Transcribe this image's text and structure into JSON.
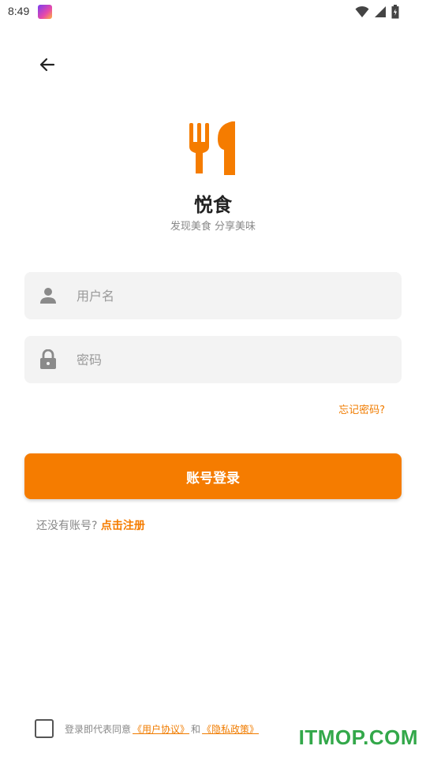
{
  "status_bar": {
    "time": "8:49",
    "icons": [
      "app-notification-icon",
      "wifi-icon",
      "signal-icon",
      "battery-icon"
    ]
  },
  "header": {
    "back_icon": "back-arrow-icon"
  },
  "brand": {
    "logo_icon": "fork-knife-icon",
    "app_name": "悦食",
    "slogan": "发现美食 分享美味",
    "accent_color": "#f57c00"
  },
  "form": {
    "username": {
      "placeholder": "用户名",
      "value": "",
      "icon": "person-icon"
    },
    "password": {
      "placeholder": "密码",
      "value": "",
      "icon": "lock-icon"
    },
    "forgot_password": "忘记密码?",
    "login_button": "账号登录"
  },
  "register": {
    "prompt": "还没有账号?",
    "link": "点击注册"
  },
  "agreement": {
    "checked": false,
    "prefix": "登录即代表同意",
    "user_agreement": "《用户协议》",
    "conjunction": "和",
    "privacy_policy": "《隐私政策》"
  },
  "watermark": "ITMOP.COM"
}
